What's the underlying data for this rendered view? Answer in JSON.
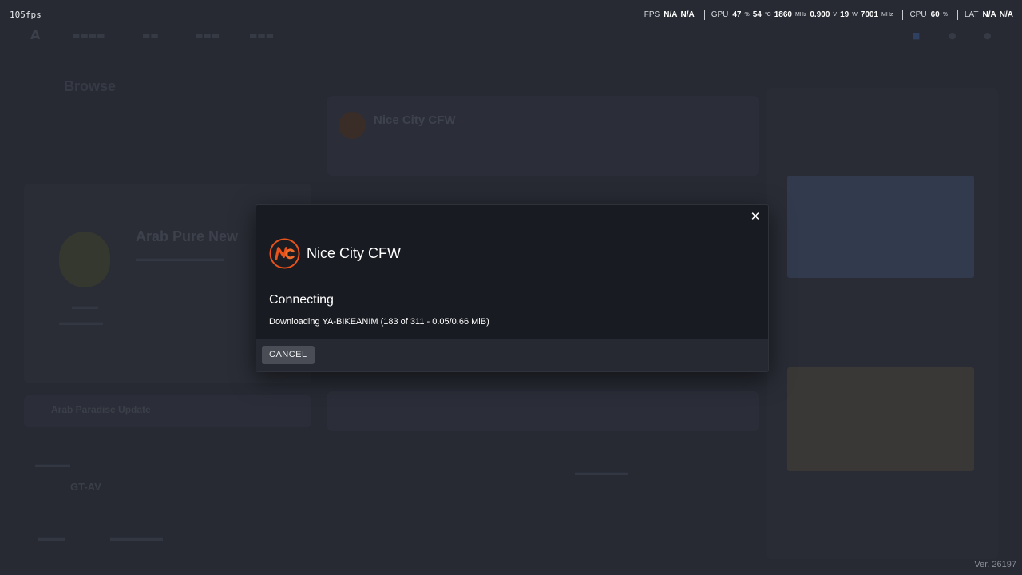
{
  "overlay": {
    "fps_counter": "105fps",
    "hud": {
      "fps": {
        "label": "FPS",
        "v1": "N/A",
        "v2": "N/A"
      },
      "gpu": {
        "label": "GPU",
        "usage": "47",
        "usage_unit": "%",
        "temp": "54",
        "temp_unit": "°C",
        "clock": "1860",
        "clock_unit": "MHz",
        "voltage": "0.900",
        "voltage_unit": "V",
        "power": "19",
        "power_unit": "W",
        "mem_clock": "7001",
        "mem_clock_unit": "MHz"
      },
      "cpu": {
        "label": "CPU",
        "usage": "60",
        "usage_unit": "%"
      },
      "lat": {
        "label": "LAT",
        "v1": "N/A",
        "v2": "N/A"
      }
    }
  },
  "modal": {
    "server_name": "Nice City CFW",
    "status": "Connecting",
    "detail": "Downloading YA-BIKEANIM (183 of 311 - 0.05/0.66 MiB)",
    "cancel_label": "CANCEL",
    "close_glyph": "✕",
    "logo_icon": "nice-city-logo-icon",
    "accent_color": "#e8531c"
  },
  "background": {
    "server_title": "Nice City CFW",
    "featured_title": "Arab Pure New",
    "browse_title": "Browse",
    "player_name": "GT-AV",
    "section_title": "Arab Paradise Update"
  },
  "footer": {
    "version": "Ver. 26197"
  }
}
